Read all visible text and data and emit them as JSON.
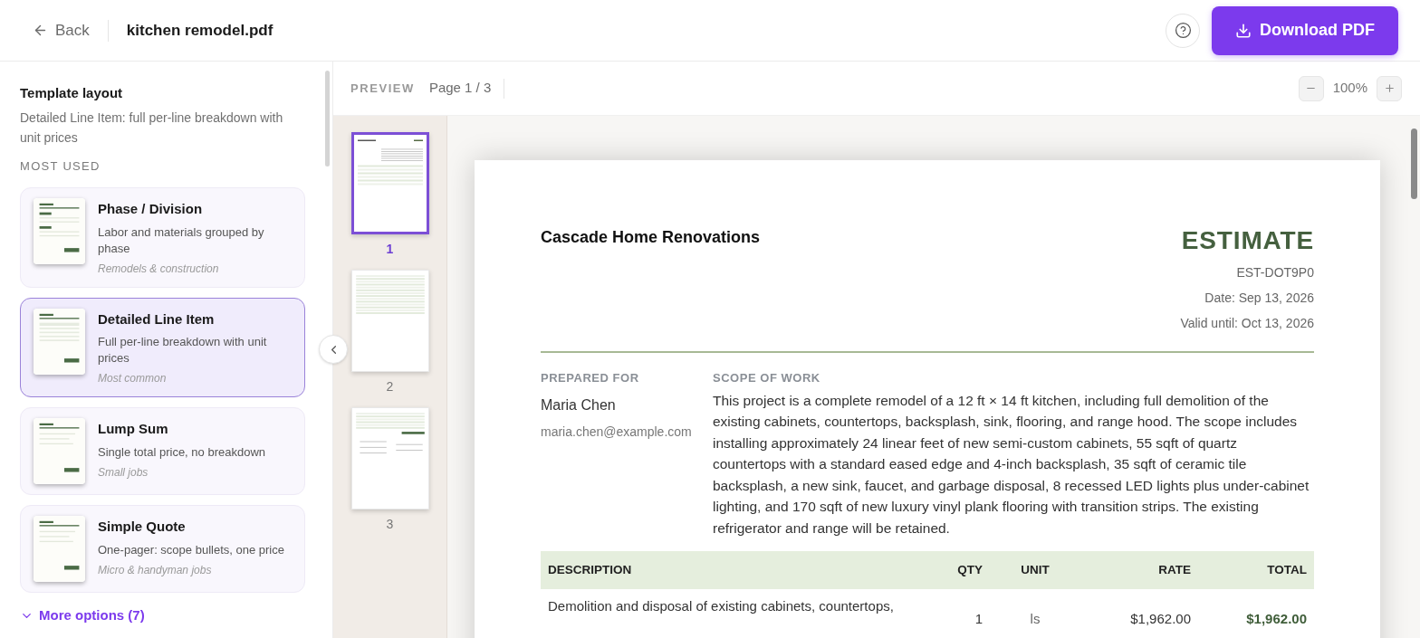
{
  "header": {
    "back": "Back",
    "file_name": "kitchen remodel.pdf",
    "download": "Download PDF"
  },
  "sidebar": {
    "title": "Template layout",
    "subtitle": "Detailed Line Item: full per-line breakdown with unit prices",
    "section": "MOST USED",
    "templates": [
      {
        "name": "Phase / Division",
        "description": "Labor and materials grouped by phase",
        "note": "Remodels & construction",
        "kind": "phases",
        "selected": false
      },
      {
        "name": "Detailed Line Item",
        "description": "Full per-line breakdown with unit prices",
        "note": "Most common",
        "kind": "lines",
        "selected": true
      },
      {
        "name": "Lump Sum",
        "description": "Single total price, no breakdown",
        "note": "Small jobs",
        "kind": "lump",
        "selected": false
      },
      {
        "name": "Simple Quote",
        "description": "One-pager: scope bullets, one price",
        "note": "Micro & handyman jobs",
        "kind": "lump",
        "selected": false
      }
    ],
    "more": "More options (7)"
  },
  "toolbar": {
    "label": "PREVIEW",
    "page": "Page 1 / 3",
    "zoom": "100%"
  },
  "thumbnails": [
    {
      "number": "1",
      "kind": "cover",
      "selected": true
    },
    {
      "number": "2",
      "kind": "table",
      "selected": false
    },
    {
      "number": "3",
      "kind": "totals",
      "selected": false
    }
  ],
  "document": {
    "company": "Cascade Home Renovations",
    "title": "ESTIMATE",
    "number": "EST-DOT9P0",
    "date": "Date: Sep 13, 2026",
    "valid_until": "Valid until: Oct 13, 2026",
    "prepared_for_label": "PREPARED FOR",
    "client_name": "Maria Chen",
    "client_email": "maria.chen@example.com",
    "scope_label": "SCOPE OF WORK",
    "scope": "This project is a complete remodel of a 12 ft × 14 ft kitchen, including full demolition of the existing cabinets, countertops, backsplash, sink, flooring, and range hood. The scope includes installing approximately 24 linear feet of new semi-custom cabinets, 55 sqft of quartz countertops with a standard eased edge and 4-inch backsplash, 35 sqft of ceramic tile backsplash, a new sink, faucet, and garbage disposal, 8 recessed LED lights plus under-cabinet lighting, and 170 sqft of new luxury vinyl plank flooring with transition strips. The existing refrigerator and range will be retained.",
    "table": {
      "columns": [
        "DESCRIPTION",
        "QTY",
        "UNIT",
        "RATE",
        "TOTAL"
      ],
      "rows": [
        {
          "description": "Demolition and disposal of existing cabinets, countertops,",
          "qty": "1",
          "unit": "ls",
          "rate": "$1,962.00",
          "total": "$1,962.00"
        }
      ]
    }
  }
}
